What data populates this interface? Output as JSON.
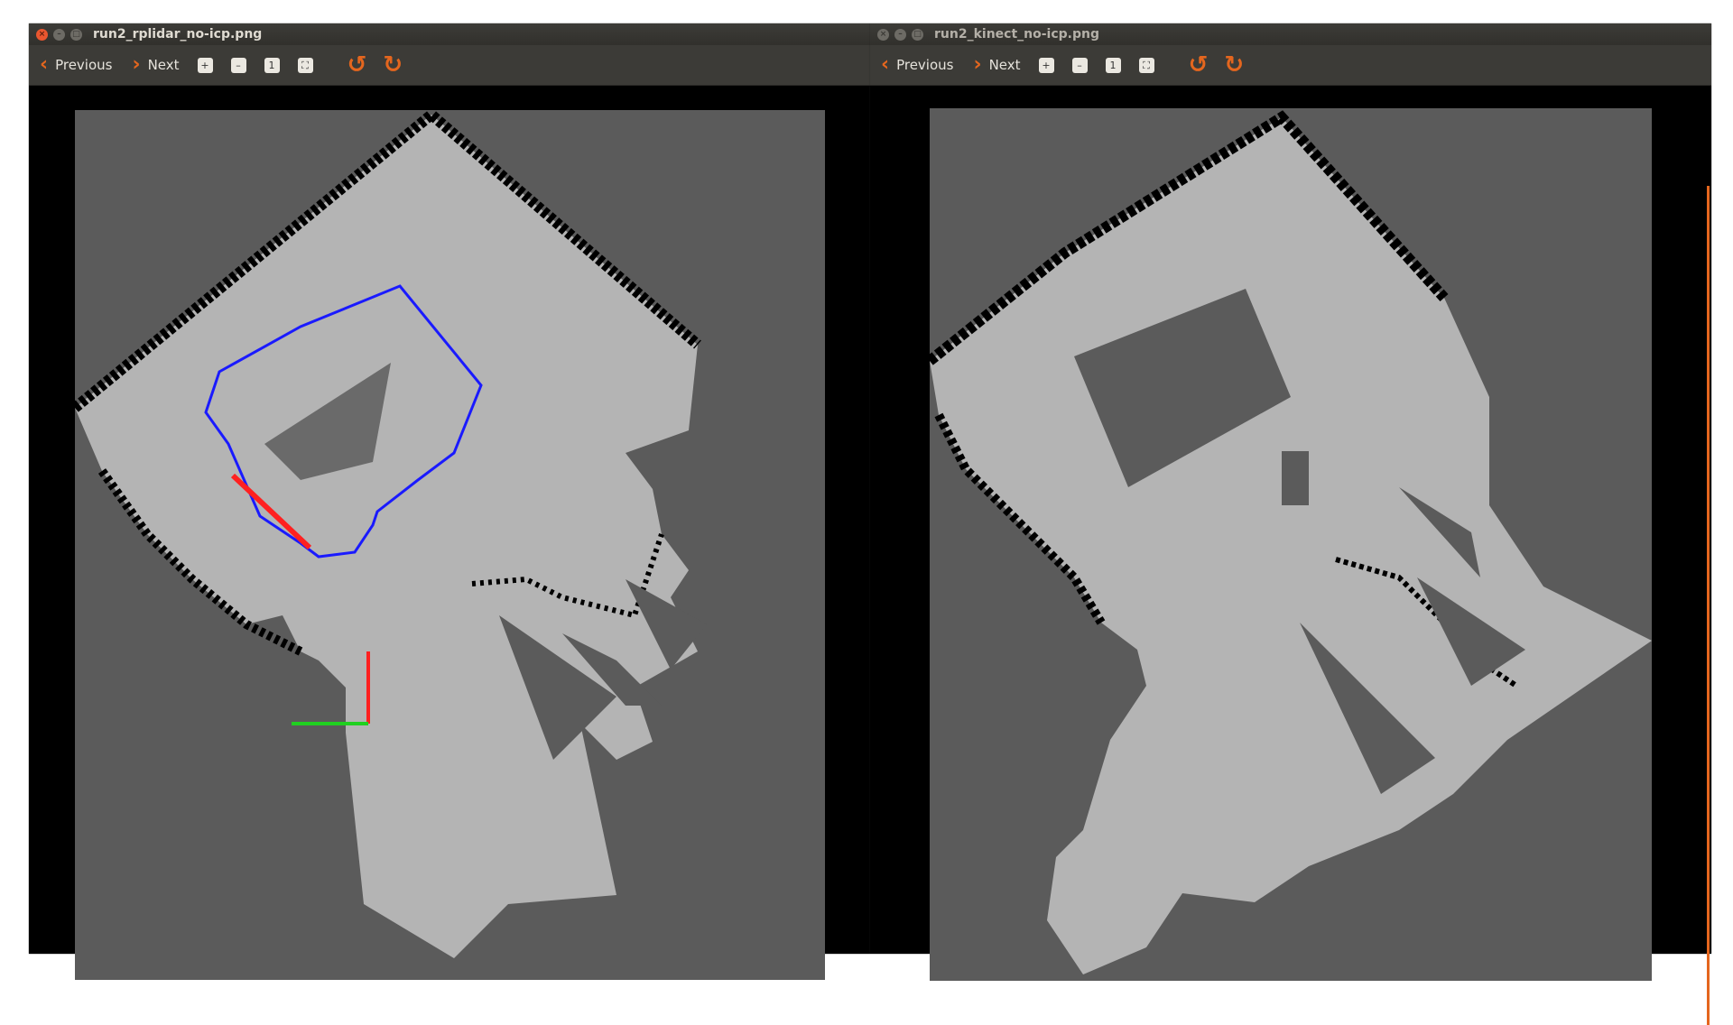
{
  "windows": [
    {
      "title": "run2_rplidar_no-icp.png",
      "toolbar": {
        "previous_label": "Previous",
        "next_label": "Next"
      }
    },
    {
      "title": "run2_kinect_no-icp.png",
      "toolbar": {
        "previous_label": "Previous",
        "next_label": "Next"
      }
    }
  ],
  "colors": {
    "accent": "#e4661e",
    "unknown_space": "#5b5b5b",
    "free_space": "#b4b4b4",
    "obstacle": "#000000",
    "path": "#1a1aff",
    "axis_x": "#ff2020",
    "axis_y": "#20d020"
  },
  "icons": {
    "close": "close-icon",
    "minimize": "minimize-icon",
    "maximize": "maximize-icon",
    "previous": "chevron-left-icon",
    "next": "chevron-right-icon",
    "zoom_in": "zoom-in-icon",
    "zoom_out": "zoom-out-icon",
    "zoom_normal": "zoom-normal-icon",
    "best_fit": "best-fit-icon",
    "rotate_left": "rotate-left-icon",
    "rotate_right": "rotate-right-icon"
  }
}
